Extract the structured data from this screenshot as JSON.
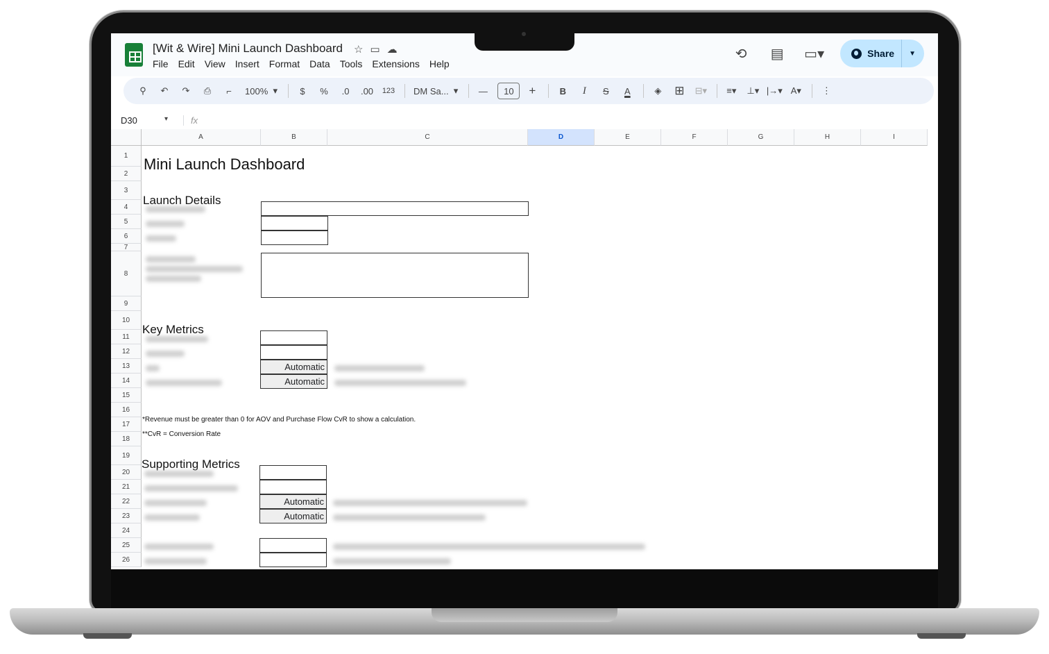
{
  "doc_title": "[Wit & Wire] Mini Launch Dashboard",
  "menu": [
    "File",
    "Edit",
    "View",
    "Insert",
    "Format",
    "Data",
    "Tools",
    "Extensions",
    "Help"
  ],
  "share_label": "Share",
  "toolbar": {
    "zoom": "100%",
    "currency": "$",
    "percent": "%",
    "dec_decrease": ".0",
    "dec_increase": ".00",
    "format_123": "123",
    "font": "DM Sa...",
    "font_size": "10",
    "bold": "B",
    "italic": "I",
    "text_color": "A"
  },
  "name_box": "D30",
  "fx_label": "fx",
  "columns": [
    "A",
    "B",
    "C",
    "D",
    "E",
    "F",
    "G",
    "H",
    "I"
  ],
  "selected_column": "D",
  "rows": [
    "1",
    "2",
    "3",
    "4",
    "5",
    "6",
    "7",
    "8",
    "9",
    "10",
    "11",
    "12",
    "13",
    "14",
    "15",
    "16",
    "17",
    "18",
    "19",
    "20",
    "21",
    "22",
    "23",
    "24",
    "25",
    "26"
  ],
  "sheet": {
    "title": "Mini Launch Dashboard",
    "section_launch": "Launch Details",
    "section_key": "Key Metrics",
    "section_supporting": "Supporting Metrics",
    "auto_label": "Automatic",
    "note_revenue": "*Revenue must be greater than 0 for AOV and Purchase Flow CvR to show a calculation.",
    "note_cvr": "**CvR = Conversion Rate"
  },
  "colors": {
    "accent": "#0b57d0",
    "share_bg": "#c2e7ff",
    "sheets_green": "#188038"
  }
}
